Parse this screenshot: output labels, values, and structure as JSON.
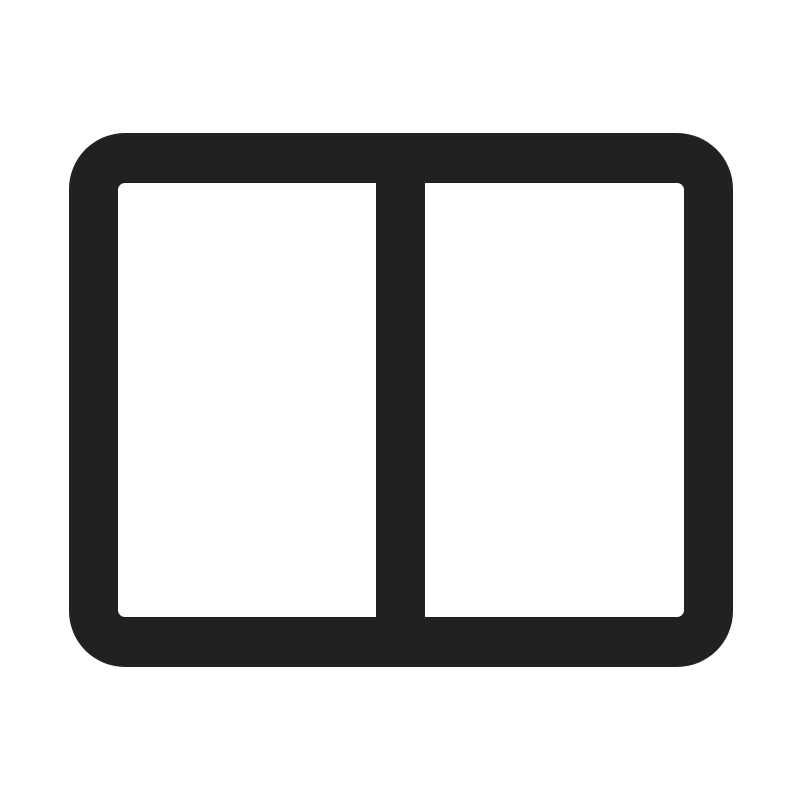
{
  "icon": {
    "name": "split-view-columns-icon",
    "stroke_color": "#212121",
    "background_color": "#ffffff"
  }
}
